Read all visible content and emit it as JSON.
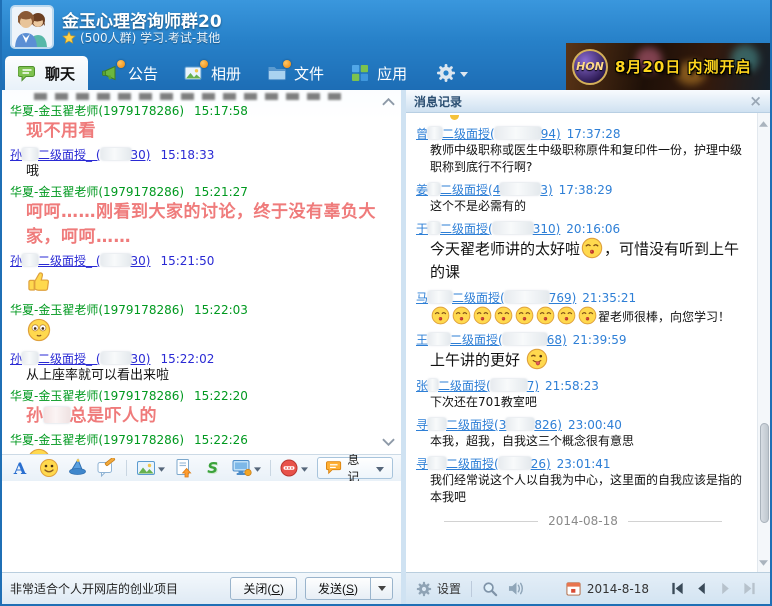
{
  "header": {
    "title": "金玉心理咨询师群20",
    "subtitle": "(500人群) 学习.考试-其他",
    "tabs": [
      {
        "id": "chat",
        "label": "聊天",
        "active": true,
        "icon": "chat-bubble-icon",
        "badge": false
      },
      {
        "id": "notice",
        "label": "公告",
        "active": false,
        "icon": "megaphone-icon",
        "badge": true
      },
      {
        "id": "album",
        "label": "相册",
        "active": false,
        "icon": "photo-icon",
        "badge": true
      },
      {
        "id": "files",
        "label": "文件",
        "active": false,
        "icon": "folder-icon",
        "badge": true
      },
      {
        "id": "apps",
        "label": "应用",
        "active": false,
        "icon": "apps-icon",
        "badge": false
      }
    ],
    "ad": {
      "logo_text": "HON",
      "text": "8月20日 内测开启"
    }
  },
  "chat": {
    "messages": [
      {
        "color": "green",
        "sender": [
          {
            "t": "华夏-金玉翟老师(1979178286)"
          }
        ],
        "time": "15:17:58",
        "style": "red-large",
        "body": [
          {
            "t": "现不用看"
          }
        ]
      },
      {
        "color": "blue",
        "sender": [
          {
            "t": "孙"
          },
          {
            "b": 16
          },
          {
            "t": "二级面授_ ("
          },
          {
            "b": 30
          },
          {
            "t": "30)"
          }
        ],
        "time": "15:18:33",
        "style": "normal",
        "body": [
          {
            "t": "哦"
          }
        ]
      },
      {
        "color": "green",
        "sender": [
          {
            "t": "华夏-金玉翟老师(1979178286)"
          }
        ],
        "time": "15:21:27",
        "style": "red-large",
        "body": [
          {
            "t": "呵呵……刚看到大家的讨论，终于没有辜负大家，呵呵……"
          }
        ]
      },
      {
        "color": "blue",
        "sender": [
          {
            "t": "孙"
          },
          {
            "b": 16
          },
          {
            "t": "二级面授_ ("
          },
          {
            "b": 30
          },
          {
            "t": "30)"
          }
        ],
        "time": "15:21:50",
        "style": "emoji",
        "body": [
          {
            "e": "thumbs-up"
          }
        ]
      },
      {
        "color": "green",
        "sender": [
          {
            "t": "华夏-金玉翟老师(1979178286)"
          }
        ],
        "time": "15:22:03",
        "style": "emoji",
        "body": [
          {
            "e": "flushed"
          }
        ]
      },
      {
        "color": "blue",
        "sender": [
          {
            "t": "孙"
          },
          {
            "b": 16
          },
          {
            "t": "二级面授_ ("
          },
          {
            "b": 30
          },
          {
            "t": "30)"
          }
        ],
        "time": "15:22:02",
        "style": "normal",
        "body": [
          {
            "t": "从上座率就可以看出来啦"
          }
        ]
      },
      {
        "color": "green",
        "sender": [
          {
            "t": "华夏-金玉翟老师(1979178286)"
          }
        ],
        "time": "15:22:20",
        "style": "red-large",
        "body": [
          {
            "t": "孙"
          },
          {
            "b": 26
          },
          {
            "t": "总是吓人的"
          }
        ]
      },
      {
        "color": "green",
        "sender": [
          {
            "t": "华夏-金玉翟老师(1979178286)"
          }
        ],
        "time": "15:22:26",
        "style": "emoji",
        "body": [
          {
            "e": "titter"
          }
        ]
      }
    ]
  },
  "history": {
    "title": "消息记录",
    "messages": [
      {
        "sender": [
          {
            "t": "曾"
          },
          {
            "b": 14
          },
          {
            "t": "二级面授("
          },
          {
            "b": 46
          },
          {
            "t": "94)"
          }
        ],
        "time": "17:37:28",
        "style": "normal",
        "body": [
          {
            "t": "教师中级职称或医生中级职称原件和复印件一份，护理中级职称到底行不行啊?"
          }
        ]
      },
      {
        "sender": [
          {
            "t": "姜"
          },
          {
            "b": 12
          },
          {
            "t": "二级面授(4"
          },
          {
            "b": 40
          },
          {
            "t": "3)"
          }
        ],
        "time": "17:38:29",
        "style": "normal",
        "body": [
          {
            "t": "这个不是必需有的"
          }
        ]
      },
      {
        "sender": [
          {
            "t": "于"
          },
          {
            "b": 12
          },
          {
            "t": "二级面授("
          },
          {
            "b": 40
          },
          {
            "t": "310)"
          }
        ],
        "time": "20:16:06",
        "style": "large",
        "body": [
          {
            "t": "今天翟老师讲的太好啦"
          },
          {
            "e": "smug"
          },
          {
            "t": "，可惜没有听到上午的课"
          }
        ]
      },
      {
        "sender": [
          {
            "t": "马"
          },
          {
            "b": 24
          },
          {
            "t": "二级面授("
          },
          {
            "b": 44
          },
          {
            "t": "769)"
          }
        ],
        "time": "21:35:21",
        "style": "normal",
        "body": [
          {
            "e": "smug",
            "n": 8
          },
          {
            "t": "翟老师很棒，向您学习！"
          }
        ]
      },
      {
        "sender": [
          {
            "t": "王"
          },
          {
            "b": 22
          },
          {
            "t": "二级面授("
          },
          {
            "b": 44
          },
          {
            "t": "68)"
          }
        ],
        "time": "21:39:59",
        "style": "large",
        "body": [
          {
            "t": "上午讲的更好 "
          },
          {
            "e": "tongue"
          }
        ]
      },
      {
        "sender": [
          {
            "t": "张"
          },
          {
            "b": 10
          },
          {
            "t": "二级面授("
          },
          {
            "b": 36
          },
          {
            "t": "7)"
          }
        ],
        "time": "21:58:23",
        "style": "normal",
        "body": [
          {
            "t": "下次还在701教室吧"
          }
        ]
      },
      {
        "sender": [
          {
            "t": "寻"
          },
          {
            "b": 18
          },
          {
            "t": "二级面授(3"
          },
          {
            "b": 28
          },
          {
            "t": "826)"
          }
        ],
        "time": "23:00:40",
        "style": "normal",
        "body": [
          {
            "t": "本我，超我，自我这三个概念很有意思"
          }
        ]
      },
      {
        "sender": [
          {
            "t": "寻"
          },
          {
            "b": 18
          },
          {
            "t": "二级面授("
          },
          {
            "b": 32
          },
          {
            "t": "26)"
          }
        ],
        "time": "23:01:41",
        "style": "normal",
        "body": [
          {
            "t": "我们经常说这个人以自我为中心，这里面的自我应该是指的本我吧"
          }
        ]
      }
    ],
    "date_divider": "2014-08-18"
  },
  "composer": {
    "tools": [
      {
        "name": "font-icon"
      },
      {
        "name": "emoticon-icon"
      },
      {
        "name": "magic-emoticon-icon"
      },
      {
        "name": "graffiti-icon"
      },
      {
        "name": "image-icon",
        "caret": true,
        "sep_before": true
      },
      {
        "name": "send-file-icon"
      },
      {
        "name": "screenshot-icon"
      },
      {
        "name": "screen-share-icon",
        "caret": true
      },
      {
        "name": "voice-icon",
        "caret": true,
        "sep_before": true
      }
    ],
    "history_toggle_label": "消息记录"
  },
  "footer": {
    "status_text": "非常适合个人开网店的创业项目",
    "close_button": {
      "pre": "关闭(",
      "key": "C",
      "post": ")"
    },
    "send_button": {
      "pre": "发送(",
      "key": "S",
      "post": ")"
    }
  },
  "history_toolbar": {
    "settings_label": "设置",
    "date": "2014-8-18"
  },
  "colors": {
    "header_blue": "#2781c9",
    "green_name": "#00991f",
    "blue_name": "#2a2ad4",
    "history_name_blue": "#2e7fd6",
    "red_message": "#ef7b7b",
    "ad_gold": "#ffd61e"
  }
}
